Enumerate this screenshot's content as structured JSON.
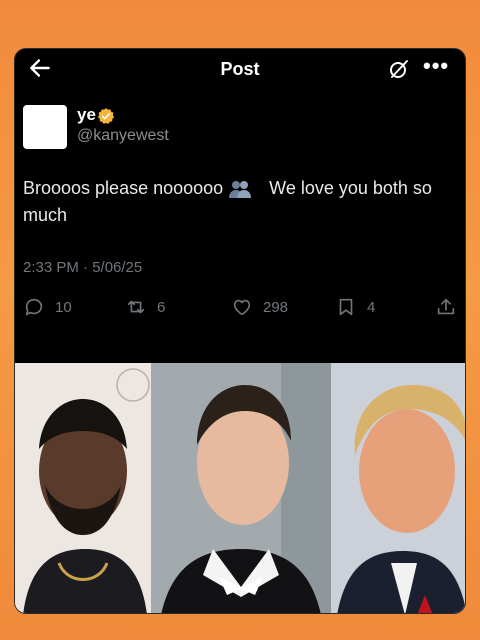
{
  "header": {
    "title": "Post",
    "back_icon": "arrow-left-icon",
    "grok_icon": "grok-icon",
    "more_label": "•••"
  },
  "author": {
    "display_name": "ye",
    "handle": "@kanyewest",
    "verified": true,
    "verified_color": "#f4b43a"
  },
  "tweet": {
    "text_before_emoji": "Broooos please noooooo",
    "emoji": "busts-in-silhouette",
    "text_after_emoji": "We love you both so much",
    "timestamp": "2:33 PM · 5/06/25"
  },
  "stats": {
    "replies": "10",
    "reposts": "6",
    "likes": "298",
    "bookmarks": "4"
  },
  "colors": {
    "background": "#000000",
    "text": "#e7e9ea",
    "muted": "#71767b",
    "frame": "#f28a3c"
  }
}
